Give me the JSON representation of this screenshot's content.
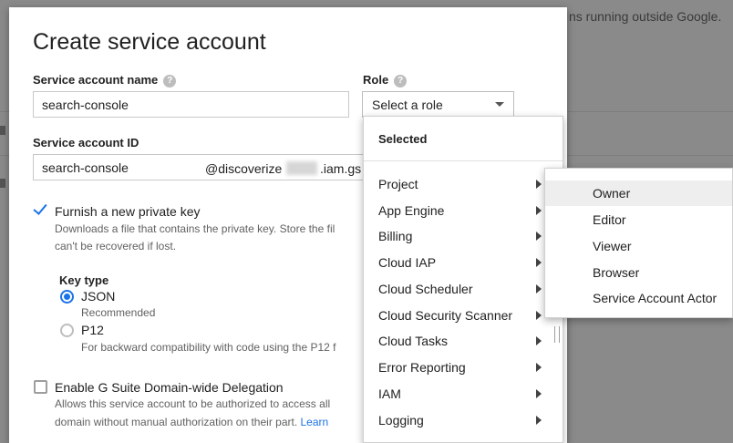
{
  "background": {
    "partial_text": "ns running outside Google."
  },
  "dialog": {
    "title": "Create service account",
    "name_label": "Service account name",
    "name_value": "search-console",
    "role_label": "Role",
    "role_placeholder": "Select a role",
    "id_label": "Service account ID",
    "id_value": "search-console",
    "id_suffix_a": "@discoverize",
    "id_suffix_b": ".iam.gs",
    "help_glyph": "?"
  },
  "private_key": {
    "checked": true,
    "label": "Furnish a new private key",
    "desc_line1": "Downloads a file that contains the private key. Store the fil",
    "desc_line2": "can't be recovered if lost."
  },
  "key_type": {
    "label": "Key type",
    "options": [
      {
        "label": "JSON",
        "desc": "Recommended",
        "selected": true
      },
      {
        "label": "P12",
        "desc": "For backward compatibility with code using the P12 f",
        "selected": false
      }
    ]
  },
  "gsuite": {
    "checked": false,
    "label": "Enable G Suite Domain-wide Delegation",
    "desc_line1": "Allows this service account to be authorized to access all",
    "desc_line2": "domain without manual authorization on their part.",
    "link": "Learn"
  },
  "role_menu": {
    "header": "Selected",
    "items": [
      "Project",
      "App Engine",
      "Billing",
      "Cloud IAP",
      "Cloud Scheduler",
      "Cloud Security Scanner",
      "Cloud Tasks",
      "Error Reporting",
      "IAM",
      "Logging"
    ]
  },
  "sub_menu": {
    "items": [
      "Owner",
      "Editor",
      "Viewer",
      "Browser",
      "Service Account Actor"
    ],
    "hovered": "Owner"
  },
  "colors": {
    "accent": "#1a73e8",
    "overlay": "#8a8a8a"
  },
  "icons": {
    "checkmark": "check-icon",
    "caret": "chevron-down-icon",
    "submenu": "chevron-right-icon",
    "help": "help-icon"
  }
}
